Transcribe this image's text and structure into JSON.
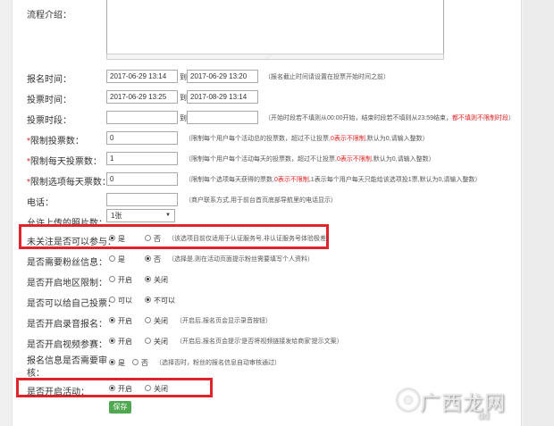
{
  "intro": {
    "label": "流程介绍："
  },
  "signup_time": {
    "label": "报名时间：",
    "start": "2017-06-29 13:14",
    "to": "到",
    "end": "2017-06-29 13:20",
    "hint": "（报名截止时间请设置在投票开始时间之前）"
  },
  "vote_time": {
    "label": "投票时间：",
    "start": "2017-06-29 13:25",
    "to": "到",
    "end": "2017-08-29 13:14"
  },
  "vote_period": {
    "label": "投票时段：",
    "start": "",
    "to": "到",
    "end": "",
    "hint_a": "（开始时段若不填则从00:00开始，结束时段若不填则从23:59结束，",
    "hint_b": "都不填则不限制时段",
    "hint_c": "）"
  },
  "limit_total": {
    "star": "*",
    "label": "限制投票数：",
    "value": "0",
    "hint_a": "（限制每个用户每个活动总的投票数，超过不让投票,",
    "hint_b": "0表示不限制",
    "hint_c": ",默认为0,请输入整数）"
  },
  "limit_daily": {
    "star": "*",
    "label": "限制每天投票数：",
    "value": "1",
    "hint_a": "（限制每个用户每个活动每天的投票数，超过不让投票,",
    "hint_b": "0表示不限制",
    "hint_c": ",默认为0,请输入整数）"
  },
  "limit_option": {
    "star": "*",
    "label": "限制选项每天票数：",
    "value": "0",
    "hint_a": "（限制每个选项每天获得的票数,",
    "hint_b": "0表示不限制",
    "hint_c": ",1表示每个用户每天只能给该选项投1票,默认为0,请输入整数）"
  },
  "phone": {
    "label": "电话：",
    "value": "",
    "hint": "（商户联系方式,用于前台首页底部导航里的电话显示）"
  },
  "photo_count": {
    "label": "允许上传的照片数：",
    "value": "1张"
  },
  "follow": {
    "label": "未关注是否可以参与：",
    "opt_yes": "是",
    "opt_no": "否",
    "hint": "（该选项目前仅适用于认证服务号,非认证服务号体验极差）"
  },
  "fans_info": {
    "label": "是否需要粉丝信息：",
    "opt_yes": "是",
    "opt_no": "否",
    "hint": "（选择是,则在活动页面提示粉丝需要填写个人资料）"
  },
  "region": {
    "label": "是否开启地区限制：",
    "opt_on": "开启",
    "opt_off": "关闭"
  },
  "self_vote": {
    "label": "是否可以给自己投票：",
    "opt_yes": "可以",
    "opt_no": "不可以"
  },
  "audio_signup": {
    "label": "是否开启录音报名：",
    "opt_on": "开启",
    "opt_off": "关闭",
    "hint": "（开启后,报名页会显示录音按钮）"
  },
  "video_signup": {
    "label": "是否开启视频参赛：",
    "opt_on": "开启",
    "opt_off": "关闭",
    "hint": "（开启后,报名页会提示'是否将视频链接发给商家'提示文案）"
  },
  "review": {
    "label_1": "报名信息是否需要审",
    "label_2": "核：",
    "opt_yes": "是",
    "opt_no": "否",
    "hint": "（选择否时，粉丝的报名信息自动审核通过）"
  },
  "activity": {
    "label": "是否开启活动：",
    "opt_on": "开启",
    "opt_off": "关闭"
  },
  "save_label": "保存",
  "watermark": {
    "text": "广西龙网",
    "sub": "dd"
  },
  "colors": {
    "highlight": "#e0242b",
    "save": "#4fa84f",
    "required": "#e02020"
  }
}
